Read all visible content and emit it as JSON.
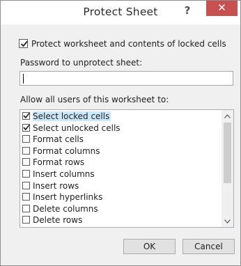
{
  "dialog": {
    "title": "Protect Sheet",
    "help_glyph": "?",
    "close_glyph": "✕"
  },
  "protect": {
    "label": "Protect worksheet and contents of locked cells",
    "checked": true
  },
  "password": {
    "label": "Password to unprotect sheet:",
    "value": ""
  },
  "allow": {
    "label": "Allow all users of this worksheet to:",
    "items": [
      {
        "label": "Select locked cells",
        "checked": true,
        "selected": true
      },
      {
        "label": "Select unlocked cells",
        "checked": true,
        "selected": false
      },
      {
        "label": "Format cells",
        "checked": false,
        "selected": false
      },
      {
        "label": "Format columns",
        "checked": false,
        "selected": false
      },
      {
        "label": "Format rows",
        "checked": false,
        "selected": false
      },
      {
        "label": "Insert columns",
        "checked": false,
        "selected": false
      },
      {
        "label": "Insert rows",
        "checked": false,
        "selected": false
      },
      {
        "label": "Insert hyperlinks",
        "checked": false,
        "selected": false
      },
      {
        "label": "Delete columns",
        "checked": false,
        "selected": false
      },
      {
        "label": "Delete rows",
        "checked": false,
        "selected": false
      }
    ]
  },
  "scrollbar": {
    "up_icon": "chevron-up-icon",
    "down_icon": "chevron-down-icon"
  },
  "buttons": {
    "ok": "OK",
    "cancel": "Cancel"
  },
  "colors": {
    "close_red": "#c75050",
    "selection": "#cce8ff"
  }
}
